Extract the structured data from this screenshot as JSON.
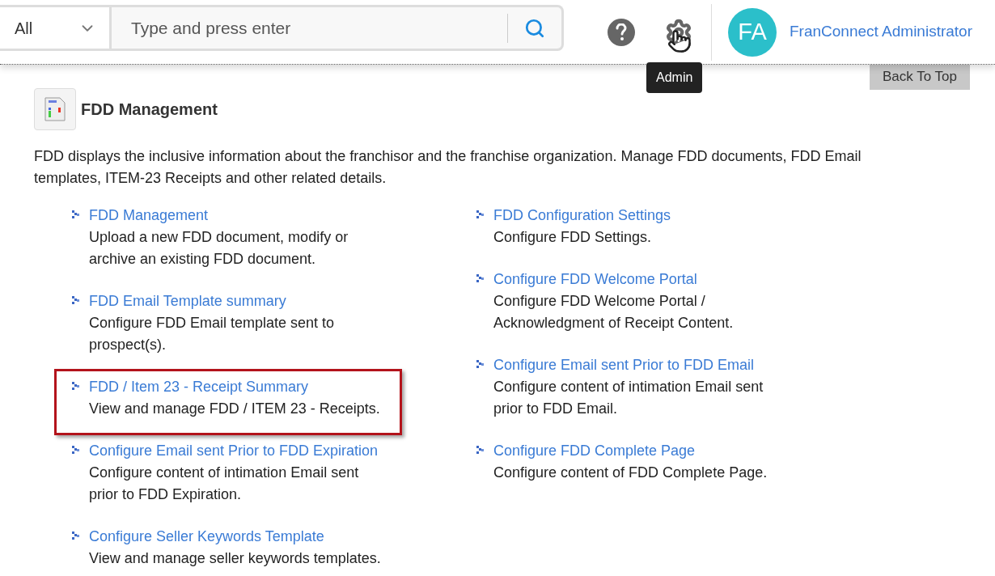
{
  "header": {
    "category_select": {
      "value": "All"
    },
    "search": {
      "placeholder": "Type and press enter"
    },
    "tooltip": "Admin",
    "user": {
      "initials": "FA",
      "name": "FranConnect Administrator"
    }
  },
  "back_to_top": "Back To Top",
  "section": {
    "title": "FDD Management",
    "description": "FDD displays the inclusive information about the franchisor and the franchise organization. Manage FDD documents, FDD Email templates, ITEM-23 Receipts and other related details."
  },
  "columns": [
    [
      {
        "title": "FDD Management",
        "description": "Upload a new FDD document, modify or archive an existing FDD document.",
        "highlighted": false
      },
      {
        "title": "FDD Email Template summary",
        "description": "Configure FDD Email template sent to prospect(s).",
        "highlighted": false
      },
      {
        "title": "FDD / Item 23 - Receipt Summary",
        "description": "View and manage FDD / ITEM 23 - Receipts.",
        "highlighted": true
      },
      {
        "title": "Configure Email sent Prior to FDD Expiration",
        "description": "Configure content of intimation Email sent prior to FDD Expiration.",
        "highlighted": false
      },
      {
        "title": "Configure Seller Keywords Template",
        "description": "View and manage seller keywords templates.",
        "highlighted": false
      }
    ],
    [
      {
        "title": "FDD Configuration Settings",
        "description": "Configure FDD Settings.",
        "highlighted": false
      },
      {
        "title": "Configure FDD Welcome Portal",
        "description": "Configure FDD Welcome Portal / Acknowledgment of Receipt Content.",
        "highlighted": false
      },
      {
        "title": "Configure Email sent Prior to FDD Email",
        "description": "Configure content of intimation Email sent prior to FDD Email.",
        "highlighted": false
      },
      {
        "title": "Configure FDD Complete Page",
        "description": "Configure content of FDD Complete Page.",
        "highlighted": false
      }
    ]
  ]
}
